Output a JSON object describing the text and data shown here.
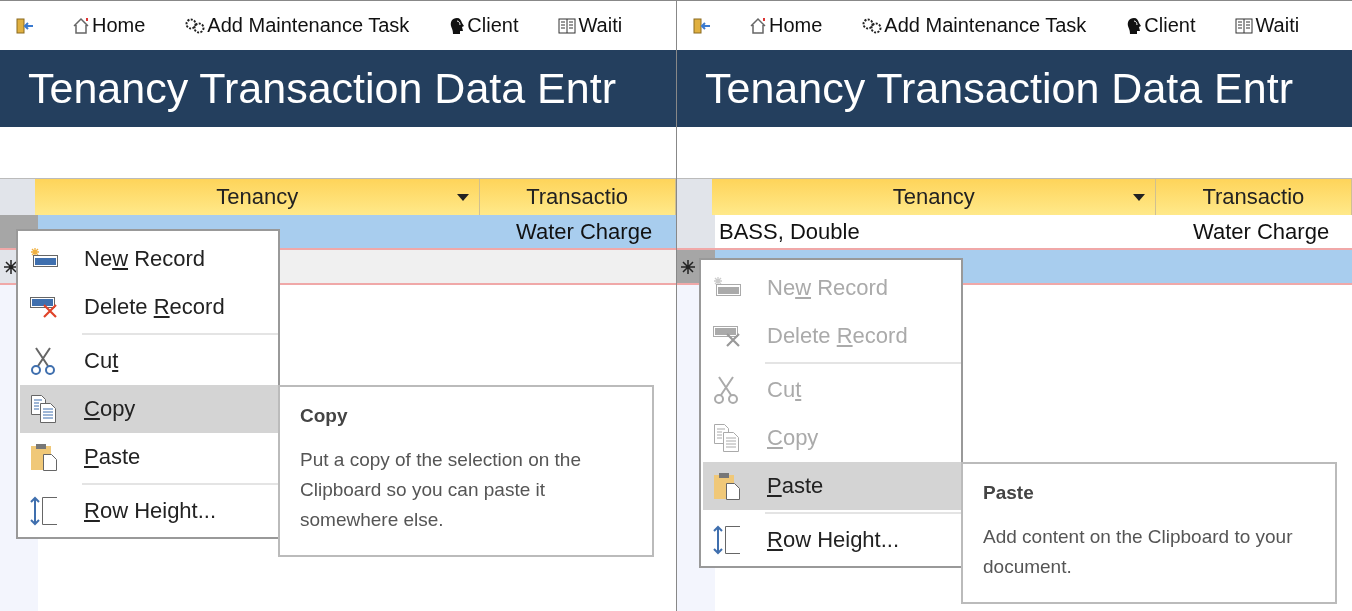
{
  "panels": [
    {
      "toolbar": [
        {
          "kind": "exit"
        },
        {
          "kind": "home",
          "label": "Home"
        },
        {
          "kind": "gears",
          "label": "Add Maintenance Task"
        },
        {
          "kind": "head",
          "label": "Client"
        },
        {
          "kind": "book",
          "label": "Waiti"
        }
      ],
      "title": "Tenancy Transaction Data Entr",
      "grid": {
        "columns": [
          {
            "label": "Tenancy",
            "filter": true
          },
          {
            "label": "Transactio",
            "filter": false
          }
        ],
        "rows": [
          {
            "cells": [
              {},
              {
                "text": "Water Charge"
              }
            ],
            "selected": true
          }
        ],
        "new_row": {
          "selected": false
        }
      },
      "context_menu": {
        "items": [
          {
            "kind": "new",
            "before": "Ne",
            "key": "w",
            "after": " Record",
            "disabled": false,
            "selected": false,
            "separator_before": false
          },
          {
            "kind": "delete",
            "before": "Delete ",
            "key": "R",
            "after": "ecord",
            "disabled": false,
            "selected": false,
            "separator_before": false
          },
          {
            "kind": "cut",
            "before": "Cu",
            "key": "t",
            "disabled": false,
            "selected": false,
            "separator_before": true
          },
          {
            "kind": "copy",
            "key": "C",
            "after": "opy",
            "disabled": false,
            "selected": true,
            "separator_before": false
          },
          {
            "kind": "paste",
            "key": "P",
            "after": "aste",
            "disabled": false,
            "selected": false,
            "separator_before": false
          },
          {
            "kind": "rowheight",
            "key": "R",
            "after": "ow Height...",
            "disabled": false,
            "selected": false,
            "separator_before": true
          }
        ],
        "tooltip": {
          "title": "Copy",
          "body": "Put a copy of the selection on the Clipboard so you can paste it somewhere else."
        }
      }
    },
    {
      "toolbar": [
        {
          "kind": "exit"
        },
        {
          "kind": "home",
          "label": "Home"
        },
        {
          "kind": "gears",
          "label": "Add Maintenance Task"
        },
        {
          "kind": "head",
          "label": "Client"
        },
        {
          "kind": "book",
          "label": "Waiti"
        }
      ],
      "title": "Tenancy Transaction Data Entr",
      "grid": {
        "columns": [
          {
            "label": "Tenancy",
            "filter": true
          },
          {
            "label": "Transactio",
            "filter": false
          }
        ],
        "rows": [
          {
            "cells": [
              {
                "text": "BASS, Double"
              },
              {
                "text": "Water Charge"
              }
            ],
            "selected": false
          }
        ],
        "new_row": {
          "selected": true
        }
      },
      "context_menu": {
        "items": [
          {
            "kind": "new",
            "before": "Ne",
            "key": "w",
            "after": " Record",
            "disabled": true,
            "selected": false,
            "separator_before": false
          },
          {
            "kind": "delete",
            "before": "Delete ",
            "key": "R",
            "after": "ecord",
            "disabled": true,
            "selected": false,
            "separator_before": false
          },
          {
            "kind": "cut",
            "before": "Cu",
            "key": "t",
            "disabled": true,
            "selected": false,
            "separator_before": true
          },
          {
            "kind": "copy",
            "key": "C",
            "after": "opy",
            "disabled": true,
            "selected": false,
            "separator_before": false
          },
          {
            "kind": "paste",
            "key": "P",
            "after": "aste",
            "disabled": false,
            "selected": true,
            "separator_before": false
          },
          {
            "kind": "rowheight",
            "key": "R",
            "after": "ow Height...",
            "disabled": false,
            "selected": false,
            "separator_before": true
          }
        ],
        "tooltip": {
          "title": "Paste",
          "body": "Add content on the Clipboard to your document."
        }
      }
    }
  ]
}
